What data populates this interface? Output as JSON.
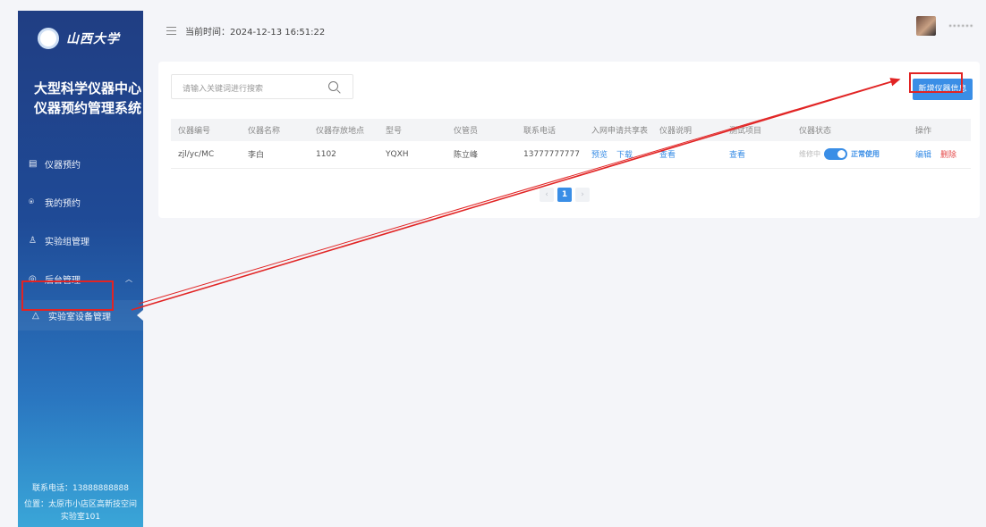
{
  "sidebar": {
    "logo_text": "山西大学",
    "title_line1": "大型科学仪器中心",
    "title_line2": "仪器预约管理系统",
    "items": [
      {
        "label": "仪器预约",
        "icon": "▤"
      },
      {
        "label": "我的预约",
        "icon": "⍟"
      },
      {
        "label": "实验组管理",
        "icon": "♙"
      },
      {
        "label": "后台管理",
        "icon": "◎",
        "caret": "︿"
      },
      {
        "label": "实验室设备管理",
        "icon": "△"
      }
    ],
    "footer_phone": "联系电话：13888888888",
    "footer_address": "位置：太原市小店区高新技空间实验室101"
  },
  "topbar": {
    "menu_icon": "list-icon",
    "time_label": "当前时间：2024-12-13 16:51:22",
    "user_name": "••••••"
  },
  "search": {
    "placeholder": "请输入关键词进行搜索"
  },
  "add_button": "新增仪器信息",
  "table": {
    "headers": [
      "仪器编号",
      "仪器名称",
      "仪器存放地点",
      "型号",
      "仪管员",
      "联系电话",
      "入网申请共享表",
      "仪器说明",
      "测试项目",
      "仪器状态",
      "操作"
    ],
    "rows": [
      {
        "code": "zjl/yc/MC",
        "name": "李白",
        "location": "1102",
        "model": "YQXH",
        "manager": "陈立峰",
        "phone": "13777777777",
        "preview": "预览",
        "download": "下载",
        "manual": "查看",
        "test_items": "查看",
        "status_off": "维修中",
        "status_on": "正常使用",
        "status_enabled": true,
        "edit": "编辑",
        "delete": "删除"
      }
    ]
  },
  "pagination": {
    "prev": "‹",
    "current": "1",
    "next": "›"
  },
  "colors": {
    "accent": "#3a8ee6",
    "annotation": "#e12424",
    "danger": "#e54b4b"
  }
}
